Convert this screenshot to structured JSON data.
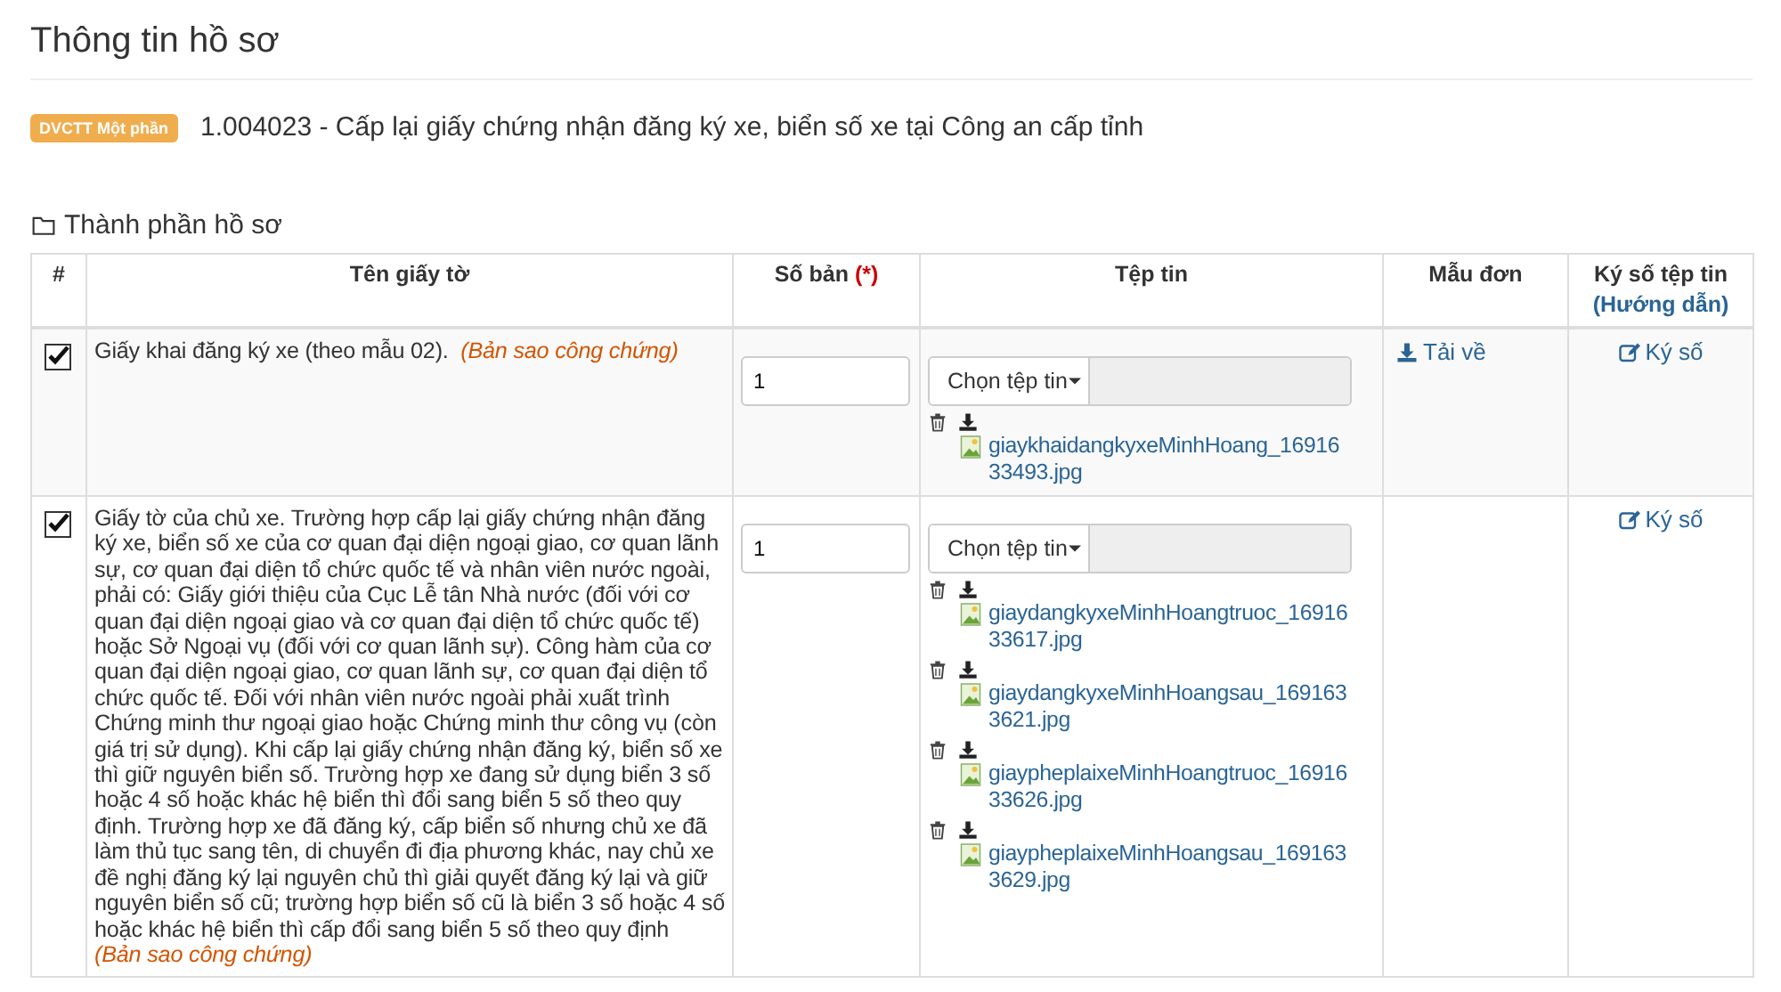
{
  "page_title": "Thông tin hồ sơ",
  "procedure": {
    "badge": "DVCTT Một phần",
    "title": "1.004023 - Cấp lại giấy chứng nhận đăng ký xe, biển số xe tại Công an cấp tỉnh"
  },
  "section_title": "Thành phần hồ sơ",
  "table": {
    "columns": [
      {
        "label": "#"
      },
      {
        "label": "Tên giấy tờ"
      },
      {
        "label": "Số bản",
        "required_mark": "(*)"
      },
      {
        "label": "Tệp tin"
      },
      {
        "label": "Mẫu đơn"
      },
      {
        "label": "Ký số tệp tin",
        "help_link": "(Hướng dẫn)"
      }
    ],
    "rows": [
      {
        "checked": true,
        "name": "Giấy khai đăng ký xe (theo mẫu 02).",
        "note": "(Bản sao công chứng)",
        "copies": "1",
        "file_button": "Chọn tệp tin",
        "files": [
          "giaykhaidangkyxeMinhHoang_1691633493.jpg"
        ],
        "template_link": "Tải về",
        "sign_link": "Ký số"
      },
      {
        "checked": true,
        "name": "Giấy tờ của chủ xe. Trường hợp cấp lại giấy chứng nhận đăng ký xe, biển số xe của cơ quan đại diện ngoại giao, cơ quan lãnh sự, cơ quan đại diện tổ chức quốc tế và nhân viên nước ngoài, phải có: Giấy giới thiệu của Cục Lễ tân Nhà nước (đối với cơ quan đại diện ngoại giao và cơ quan đại diện tổ chức quốc tế) hoặc Sở Ngoại vụ (đối với cơ quan lãnh sự). Công hàm của cơ quan đại diện ngoại giao, cơ quan lãnh sự, cơ quan đại diện tổ chức quốc tế. Đối với nhân viên nước ngoài phải xuất trình Chứng minh thư ngoại giao hoặc Chứng minh thư công vụ (còn giá trị sử dụng). Khi cấp lại giấy chứng nhận đăng ký, biển số xe thì giữ nguyên biển số. Trường hợp xe đang sử dụng biển 3 số hoặc 4 số hoặc khác hệ biển thì đổi sang biển 5 số theo quy định. Trường hợp xe đã đăng ký, cấp biển số nhưng chủ xe đã làm thủ tục sang tên, di chuyển đi địa phương khác, nay chủ xe đề nghị đăng ký lại nguyên chủ thì giải quyết đăng ký lại và giữ nguyên biển số cũ; trường hợp biển số cũ là biển 3 số hoặc 4 số hoặc khác hệ biển thì cấp đổi sang biển 5 số theo quy định",
        "note": "(Bản sao công chứng)",
        "copies": "1",
        "file_button": "Chọn tệp tin",
        "files": [
          "giaydangkyxeMinhHoangtruoc_1691633617.jpg",
          "giaydangkyxeMinhHoangsau_1691633621.jpg",
          "giaypheplaixeMinhHoangtruoc_1691633626.jpg",
          "giaypheplaixeMinhHoangsau_1691633629.jpg"
        ],
        "sign_link": "Ký số"
      }
    ]
  }
}
